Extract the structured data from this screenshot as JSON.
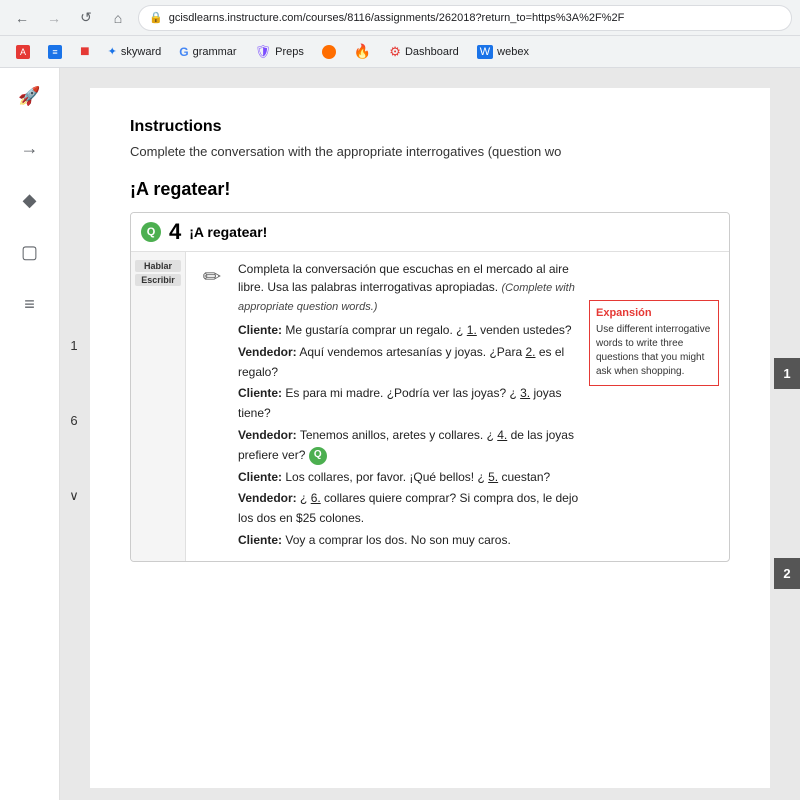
{
  "browser": {
    "url": "gcisdlearns.instructure.com/courses/8116/assignments/262018?return_to=https%3A%2F%2F",
    "lock_symbol": "🔒",
    "back_symbol": "←",
    "reload_symbol": "↺"
  },
  "bookmarks": [
    {
      "id": "app-a",
      "label": "A",
      "color": "red"
    },
    {
      "id": "app-b",
      "label": "≡",
      "color": "blue"
    },
    {
      "id": "app-square",
      "label": "■",
      "color": "red-square"
    },
    {
      "id": "skyward",
      "label": "skyward",
      "icon": "skyward"
    },
    {
      "id": "grammar",
      "label": "grammar",
      "icon": "G"
    },
    {
      "id": "preps",
      "label": "Preps",
      "icon": "preps"
    },
    {
      "id": "dot",
      "label": "",
      "icon": "dot"
    },
    {
      "id": "fire",
      "label": "",
      "icon": "fire"
    },
    {
      "id": "dashboard",
      "label": "Dashboard",
      "icon": "gear"
    },
    {
      "id": "webex",
      "label": "webex",
      "icon": "webex"
    }
  ],
  "sidebar": {
    "icons": [
      {
        "id": "rocket",
        "symbol": "🚀"
      },
      {
        "id": "arrow-right",
        "symbol": "→"
      },
      {
        "id": "pin",
        "symbol": "📌"
      },
      {
        "id": "square",
        "symbol": "▢"
      },
      {
        "id": "lines",
        "symbol": "≡"
      }
    ]
  },
  "left_nav": {
    "numbers": [
      "1",
      "6"
    ],
    "chevron": "∨"
  },
  "page": {
    "instructions_title": "Instructions",
    "instructions_text": "Complete the conversation with the appropriate interrogatives (question wo",
    "activity_title": "¡A regatear!",
    "card": {
      "number": "4",
      "title": "¡A regatear!",
      "q_label": "Q",
      "labels": [
        "Hablar",
        "Escribir"
      ],
      "instruction_main": "Completa la conversación que escuchas en el mercado al aire libre. Usa las palabras interrogativas apropiadas.",
      "instruction_italic": "(Complete with appropriate question words.)",
      "dialogue": [
        {
          "speaker": "Cliente:",
          "text": "Me gustaría comprar un regalo. ¿ ",
          "blank": "1.",
          "text2": " venden ustedes?"
        },
        {
          "speaker": "Vendedor:",
          "text": "Aquí vendemos artesanías y joyas. ¿Para ",
          "blank": "2.",
          "text2": " es el regalo?"
        },
        {
          "speaker": "Cliente:",
          "text": "Es para mi madre. ¿Podría ver las joyas? ¿ ",
          "blank": "3.",
          "text2": " joyas tiene?"
        },
        {
          "speaker": "Vendedor:",
          "text": "Tenemos anillos, aretes y collares. ¿ ",
          "blank": "4.",
          "text2": " de las joyas prefiere ver?"
        },
        {
          "speaker": "Cliente:",
          "text": "Los collares, por favor. ¡Qué bellos! ¿ ",
          "blank": "5.",
          "text2": " cuestan?"
        },
        {
          "speaker": "Vendedor:",
          "text": "¿ ",
          "blank": "6.",
          "text2": " collares quiere comprar? Si compra dos, le dejo los dos en $25 colones."
        },
        {
          "speaker": "Cliente:",
          "text": "Voy a comprar los dos. No son muy caros.",
          "blank": "",
          "text2": ""
        }
      ],
      "expansion": {
        "title": "Expansión",
        "text": "Use different interrogative words to write three questions that you might ask when shopping."
      }
    }
  },
  "right_badges": [
    "1",
    "2"
  ]
}
